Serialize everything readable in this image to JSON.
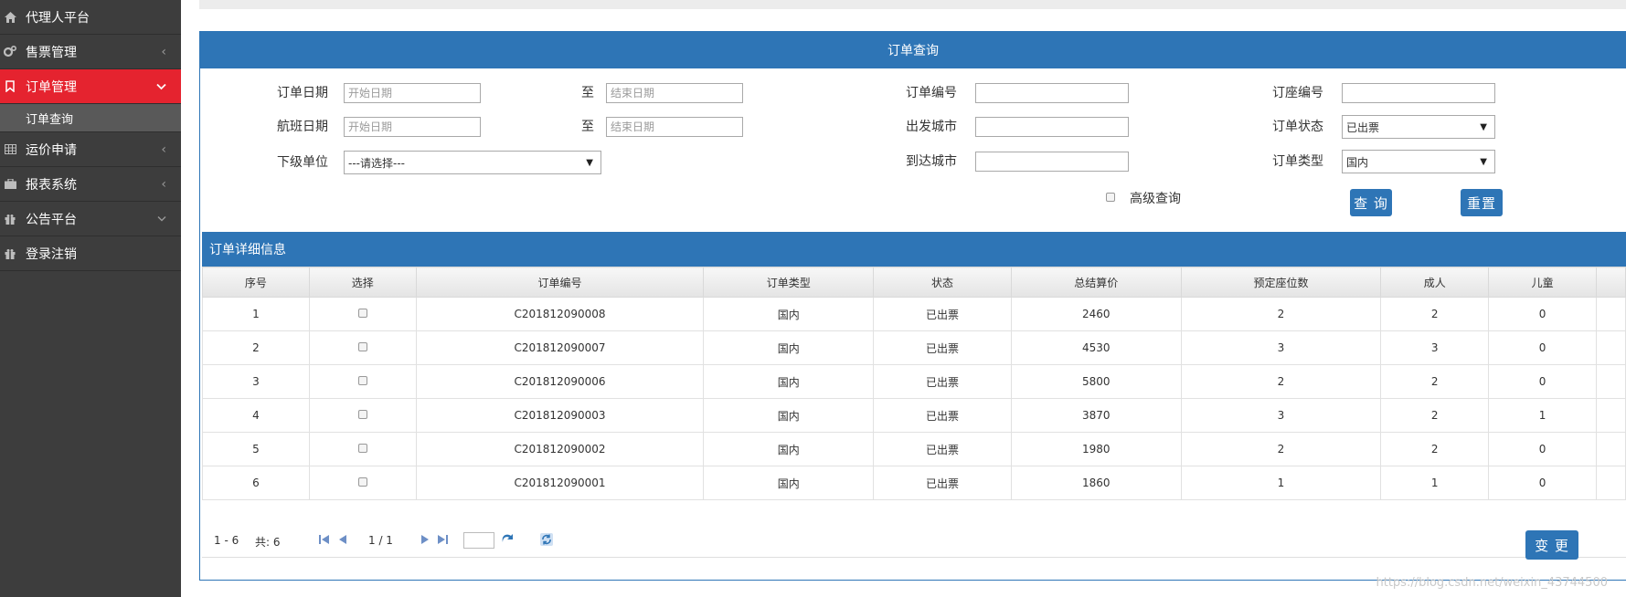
{
  "sidebar": {
    "items": [
      {
        "label": "代理人平台",
        "icon": "home-icon"
      },
      {
        "label": "售票管理",
        "icon": "gears-icon"
      },
      {
        "label": "订单管理",
        "icon": "bookmark-icon"
      },
      {
        "sub": "订单查询"
      },
      {
        "label": "运价申请",
        "icon": "table-icon"
      },
      {
        "label": "报表系统",
        "icon": "briefcase-icon"
      },
      {
        "label": "公告平台",
        "icon": "gift-icon"
      },
      {
        "label": "登录注销",
        "icon": "gift-icon"
      }
    ]
  },
  "search": {
    "title": "订单查询",
    "order_date_label": "订单日期",
    "to_label": "至",
    "start_placeholder": "开始日期",
    "end_placeholder": "结束日期",
    "flight_date_label": "航班日期",
    "sub_unit_label": "下级单位",
    "sub_unit_value": "---请选择---",
    "order_no_label": "订单编号",
    "dep_city_label": "出发城市",
    "arr_city_label": "到达城市",
    "seat_no_label": "订座编号",
    "status_label": "订单状态",
    "status_value": "已出票",
    "type_label": "订单类型",
    "type_value": "国内",
    "advanced_label": "高级查询",
    "query_button": "查 询",
    "reset_button": "重置"
  },
  "detail": {
    "title": "订单详细信息",
    "columns": [
      "序号",
      "选择",
      "订单编号",
      "订单类型",
      "状态",
      "总结算价",
      "预定座位数",
      "成人",
      "儿童"
    ],
    "rows": [
      [
        "1",
        "",
        "C201812090008",
        "国内",
        "已出票",
        "2460",
        "2",
        "2",
        "0"
      ],
      [
        "2",
        "",
        "C201812090007",
        "国内",
        "已出票",
        "4530",
        "3",
        "3",
        "0"
      ],
      [
        "3",
        "",
        "C201812090006",
        "国内",
        "已出票",
        "5800",
        "2",
        "2",
        "0"
      ],
      [
        "4",
        "",
        "C201812090003",
        "国内",
        "已出票",
        "3870",
        "3",
        "2",
        "1"
      ],
      [
        "5",
        "",
        "C201812090002",
        "国内",
        "已出票",
        "1980",
        "2",
        "2",
        "0"
      ],
      [
        "6",
        "",
        "C201812090001",
        "国内",
        "已出票",
        "1860",
        "1",
        "1",
        "0"
      ]
    ]
  },
  "pager": {
    "range": "1 - 6",
    "total": "共: 6",
    "page": "1 / 1"
  },
  "change_button": "变 更",
  "watermark": "https://blog.csdn.net/weixin_43744500",
  "colors": {
    "accent": "#2e75b6",
    "active": "#e5232f",
    "sidebar": "#3d3d3d"
  }
}
